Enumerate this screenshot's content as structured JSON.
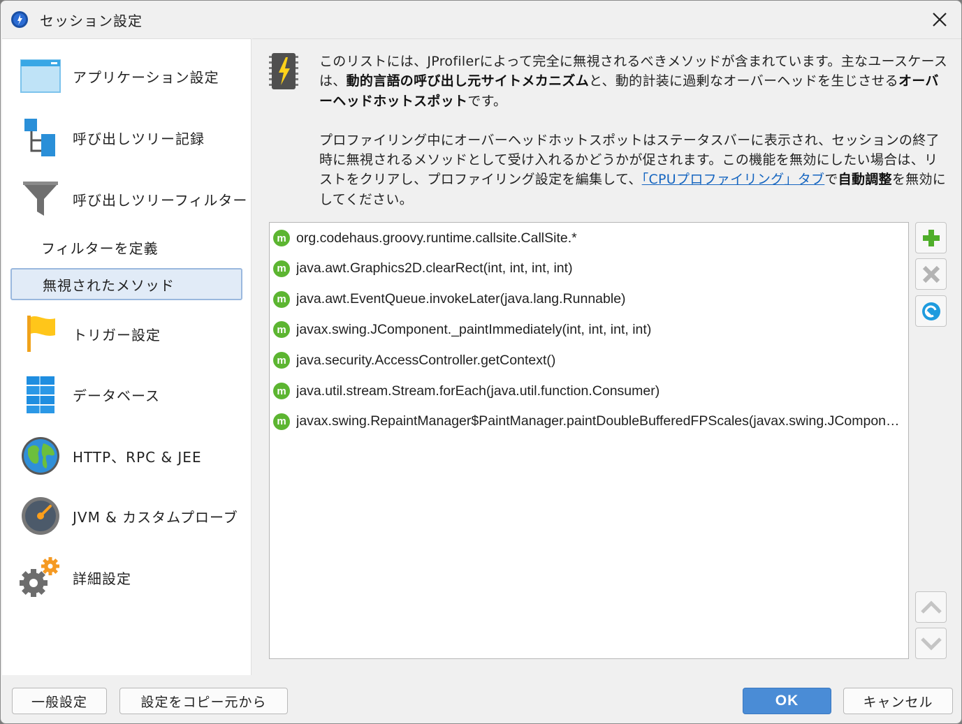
{
  "window": {
    "title": "セッション設定"
  },
  "sidebar": {
    "items": [
      {
        "label": "アプリケーション設定",
        "icon": "application-window-icon"
      },
      {
        "label": "呼び出しツリー記録",
        "icon": "call-tree-icon"
      },
      {
        "label": "呼び出しツリーフィルター",
        "icon": "funnel-icon"
      },
      {
        "label": "フィルターを定義",
        "sub": true
      },
      {
        "label": "無視されたメソッド",
        "sub": true,
        "selected": true
      },
      {
        "label": "トリガー設定",
        "icon": "flag-icon"
      },
      {
        "label": "データベース",
        "icon": "database-icon"
      },
      {
        "label": "HTTP、RPC & JEE",
        "icon": "globe-icon"
      },
      {
        "label": "JVM & カスタムプローブ",
        "icon": "gauge-icon"
      },
      {
        "label": "詳細設定",
        "icon": "gears-icon"
      }
    ]
  },
  "description": {
    "p1_a": "このリストには、JProfilerによって完全に無視されるべきメソッドが含まれています。主なユースケースは、",
    "p1_b": "動的言語の呼び出し元サイトメカニズム",
    "p1_c": "と、動的計装に過剰なオーバーヘッドを生じさせる",
    "p1_d": "オーバーヘッドホットスポット",
    "p1_e": "です。",
    "p2_a": "プロファイリング中にオーバーヘッドホットスポットはステータスバーに表示され、セッションの終了時に無視されるメソッドとして受け入れるかどうかが促されます。この機能を無効にしたい場合は、リストをクリアし、プロファイリング設定を編集して、",
    "p2_link": "「CPUプロファイリング」タブ",
    "p2_b": "で",
    "p2_c": "自動調整",
    "p2_d": "を無効にしてください。"
  },
  "methods": [
    "org.codehaus.groovy.runtime.callsite.CallSite.*",
    "java.awt.Graphics2D.clearRect(int, int, int, int)",
    "java.awt.EventQueue.invokeLater(java.lang.Runnable)",
    "javax.swing.JComponent._paintImmediately(int, int, int, int)",
    "java.security.AccessController.getContext()",
    "java.util.stream.Stream.forEach(java.util.function.Consumer)",
    "javax.swing.RepaintManager$PaintManager.paintDoubleBufferedFPScales(javax.swing.JComponent, java.awt.Image, java.awt.Graphics, int, int, int, int)"
  ],
  "method_badge": "m",
  "buttons": {
    "general": "一般設定",
    "copy": "設定をコピー元から",
    "ok": "OK",
    "cancel": "キャンセル"
  },
  "colors": {
    "accent": "#4a8cd6",
    "method_badge": "#5cb531",
    "add": "#5cb531",
    "link": "#1565c0"
  }
}
